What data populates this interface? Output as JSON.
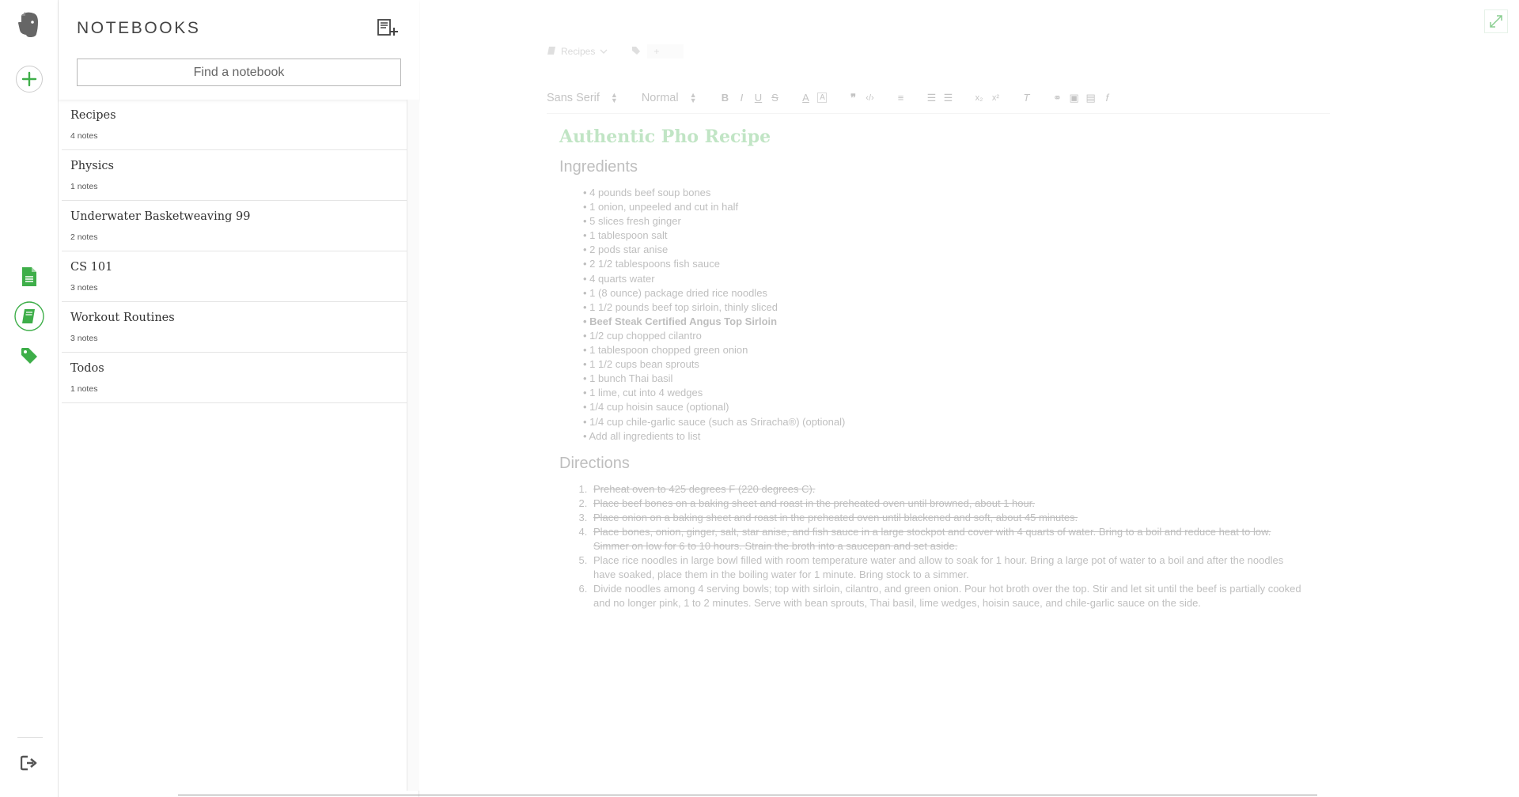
{
  "panel": {
    "title": "NOTEBOOKS",
    "search_placeholder": "Find a notebook",
    "notebooks": [
      {
        "name": "Recipes",
        "count": "4 notes"
      },
      {
        "name": "Physics",
        "count": "1 notes"
      },
      {
        "name": "Underwater Basketweaving 99",
        "count": "2 notes"
      },
      {
        "name": "CS 101",
        "count": "3 notes"
      },
      {
        "name": "Workout Routines",
        "count": "3 notes"
      },
      {
        "name": "Todos",
        "count": "1 notes"
      }
    ]
  },
  "rail": {
    "accent": "#3eae49",
    "icons": [
      "evernote-logo-icon",
      "new-note-icon",
      "notes-icon",
      "notebooks-icon",
      "tags-icon",
      "logout-icon"
    ]
  },
  "editor": {
    "notebook_label": "Recipes",
    "tag_placeholder": "+",
    "font_select": "Sans Serif",
    "size_select": "Normal",
    "note_title": "Authentic Pho Recipe",
    "ingredients_heading": "Ingredients",
    "ingredients": [
      "4 pounds beef soup bones",
      "1 onion, unpeeled and cut in half",
      "5 slices fresh ginger",
      "1 tablespoon salt",
      "2 pods star anise",
      "2 1/2 tablespoons fish sauce",
      "4 quarts water",
      "1 (8 ounce) package dried rice noodles",
      "1 1/2 pounds beef top sirloin, thinly sliced",
      "Beef Steak Certified Angus Top Sirloin",
      "1/2 cup chopped cilantro",
      "1 tablespoon chopped green onion",
      "1 1/2 cups bean sprouts",
      "1 bunch Thai basil",
      "1 lime, cut into 4 wedges",
      "1/4 cup hoisin sauce (optional)",
      "1/4 cup chile-garlic sauce (such as Sriracha®) (optional)",
      "Add all ingredients to list"
    ],
    "directions_heading": "Directions",
    "directions": [
      "Preheat oven to 425 degrees F (220 degrees C).",
      "Place beef bones on a baking sheet and roast in the preheated oven until browned, about 1 hour.",
      "Place onion on a baking sheet and roast in the preheated oven until blackened and soft, about 45 minutes.",
      "Place bones, onion, ginger, salt, star anise, and fish sauce in a large stockpot and cover with 4 quarts of water. Bring to a boil and reduce heat to low. Simmer on low for 6 to 10 hours. Strain the broth into a saucepan and set aside.",
      "Place rice noodles in large bowl filled with room temperature water and allow to soak for 1 hour. Bring a large pot of water to a boil and after the noodles have soaked, place them in the boiling water for 1 minute. Bring stock to a simmer.",
      "Divide noodles among 4 serving bowls; top with sirloin, cilantro, and green onion. Pour hot broth over the top. Stir and let sit until the beef is partially cooked and no longer pink, 1 to 2 minutes. Serve with bean sprouts, Thai basil, lime wedges, hoisin sauce, and chile-garlic sauce on the side."
    ]
  }
}
